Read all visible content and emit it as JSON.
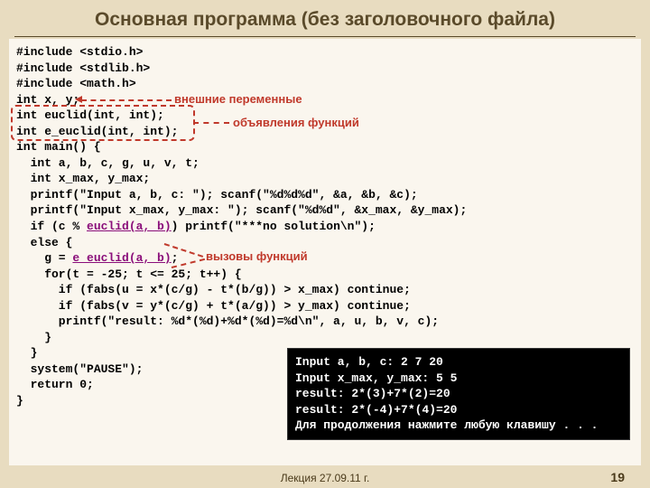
{
  "title": "Основная программа (без заголовочного файла)",
  "code": {
    "l1": "#include <stdio.h>",
    "l2": "#include <stdlib.h>",
    "l3": "#include <math.h>",
    "l4": "int x, y;",
    "l5": "int euclid(int, int);",
    "l6": "int e_euclid(int, int);",
    "l7": "int main() {",
    "l8": "  int a, b, c, g, u, v, t;",
    "l9": "  int x_max, y_max;",
    "l10": "  printf(\"Input a, b, c: \"); scanf(\"%d%d%d\", &a, &b, &c);",
    "l11": "  printf(\"Input x_max, y_max: \"); scanf(\"%d%d\", &x_max, &y_max);",
    "l12a": "  if (c % ",
    "l12b": "euclid(a, b)",
    "l12c": ") printf(\"***no solution\\n\");",
    "l13": "  else {",
    "l14a": "    g = ",
    "l14b": "e_euclid(a, b)",
    "l14c": ";",
    "l15": "    for(t = -25; t <= 25; t++) {",
    "l16": "      if (fabs(u = x*(c/g) - t*(b/g)) > x_max) continue;",
    "l17": "      if (fabs(v = y*(c/g) + t*(a/g)) > y_max) continue;",
    "l18": "      printf(\"result: %d*(%d)+%d*(%d)=%d\\n\", a, u, b, v, c);",
    "l19": "    }",
    "l20": "  }",
    "l21": "  system(\"PAUSE\");",
    "l22": "  return 0;",
    "l23": "}"
  },
  "annotations": {
    "ext_vars": "внешние переменные",
    "func_decls": "объявления функций",
    "func_calls": "вызовы функций"
  },
  "terminal": {
    "t1": "Input a, b, c: 2 7 20",
    "t2": "Input x_max, y_max: 5 5",
    "t3": "result: 2*(3)+7*(2)=20",
    "t4": "result: 2*(-4)+7*(4)=20",
    "t5": "Для продолжения нажмите любую клавишу . . ."
  },
  "footer": "Лекция 27.09.11 г.",
  "page": "19"
}
